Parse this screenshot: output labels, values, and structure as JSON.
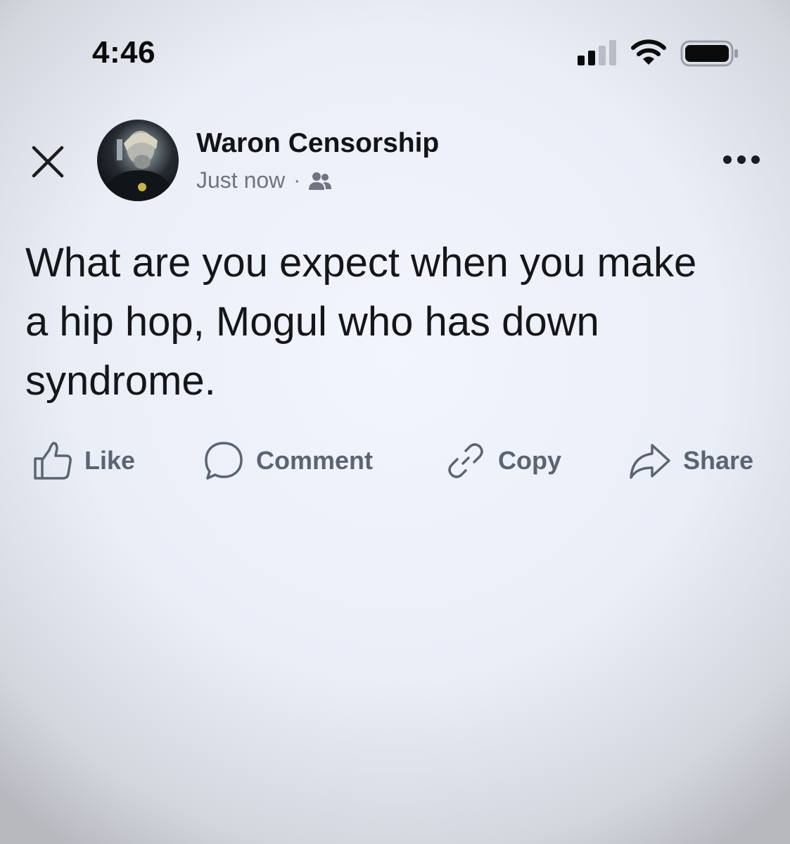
{
  "status_bar": {
    "time": "4:46"
  },
  "post": {
    "author": "Waron Censorship",
    "timestamp": "Just now",
    "separator": "·",
    "audience_icon": "friends-icon",
    "text": "What are you expect when you make a hip hop, Mogul who has down syndrome."
  },
  "actions": {
    "like": "Like",
    "comment": "Comment",
    "copy": "Copy",
    "share": "Share"
  },
  "colors": {
    "text": "#151619",
    "secondary": "#6f7480",
    "action": "#5c6472"
  }
}
